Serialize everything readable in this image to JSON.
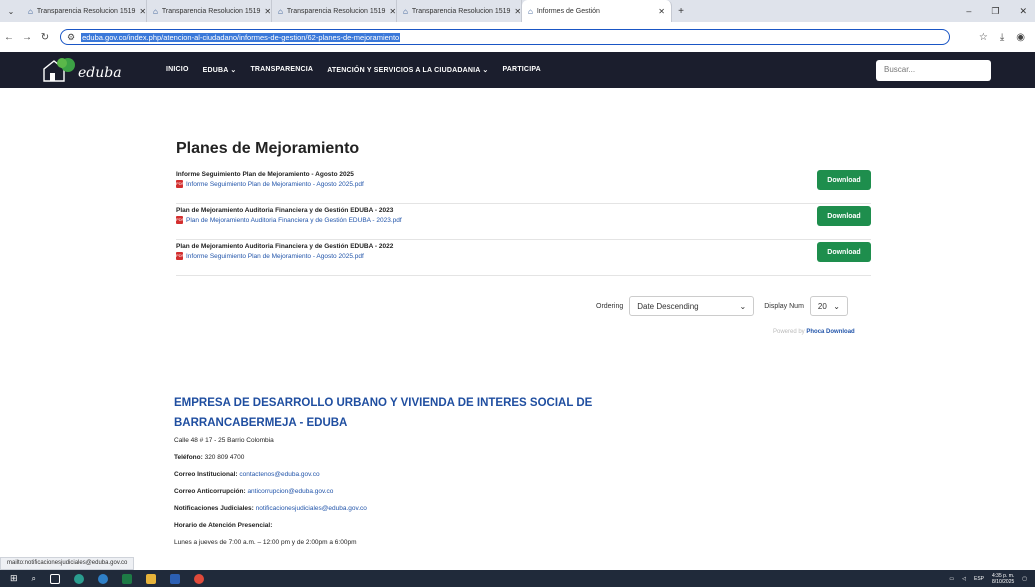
{
  "browser": {
    "tabs": [
      {
        "title": "Transparencia Resolucion 1519"
      },
      {
        "title": "Transparencia Resolucion 1519"
      },
      {
        "title": "Transparencia Resolucion 1519"
      },
      {
        "title": "Transparencia Resolucion 1519"
      },
      {
        "title": "Informes de Gestión",
        "active": true
      }
    ],
    "url": "eduba.gov.co/index.php/atencion-al-ciudadano/informes-de-gestion/62-planes-de-mejoramiento",
    "status_url": "mailto:notificacionesjudiciales@eduba.gov.co"
  },
  "site": {
    "logo_text": "eduba",
    "menu": [
      "INICIO",
      "EDUBA ⌄",
      "TRANSPARENCIA",
      "ATENCIÓN Y SERVICIOS A LA CIUDADANIA ⌄",
      "PARTICIPA"
    ],
    "search_placeholder": "Buscar..."
  },
  "main": {
    "title": "Planes de Mejoramiento",
    "documents": [
      {
        "title": "Informe Seguimiento Plan de Mejoramiento - Agosto 2025",
        "file": "Informe Seguimiento Plan de Mejoramiento - Agosto 2025.pdf",
        "button": "Download"
      },
      {
        "title": "Plan de Mejoramiento Auditoria Financiera y de Gestión EDUBA - 2023",
        "file": "Plan de Mejoramiento Auditoria Financiera y de Gestión EDUBA - 2023.pdf",
        "button": "Download"
      },
      {
        "title": "Plan de Mejoramiento Auditoria Financiera y de Gestión EDUBA - 2022",
        "file": "Informe Seguimiento Plan de Mejoramiento - Agosto 2025.pdf",
        "button": "Download"
      }
    ],
    "ordering_label": "Ordering",
    "ordering_value": "Date Descending",
    "display_label": "Display Num",
    "display_value": "20",
    "powered_by": "Powered by",
    "powered_link": "Phoca Download"
  },
  "footer": {
    "org_name": "EMPRESA DE DESARROLLO URBANO Y VIVIENDA DE INTERES SOCIAL DE BARRANCABERMEJA - EDUBA",
    "address": "Calle 48 # 17 - 25 Barrio Colombia",
    "phone_label": "Teléfono:",
    "phone": "320 809 4700",
    "email_inst_label": "Correo Institucional:",
    "email_inst": "contactenos@eduba.gov.co",
    "email_anti_label": "Correo Anticorrupción:",
    "email_anti": "anticorrupcion@eduba.gov.co",
    "notif_label": "Notificaciones Judiciales:",
    "notif": "notificacionesjudiciales@eduba.gov.co",
    "hours_label": "Horario de Atención Presencial:",
    "hours": "Lunes a jueves de 7:00 a.m. – 12:00 pm y de 2:00pm a 6:00pm"
  },
  "taskbar": {
    "lang": "ESP",
    "time": "4:35 p. m.",
    "date": "8/10/2025"
  }
}
